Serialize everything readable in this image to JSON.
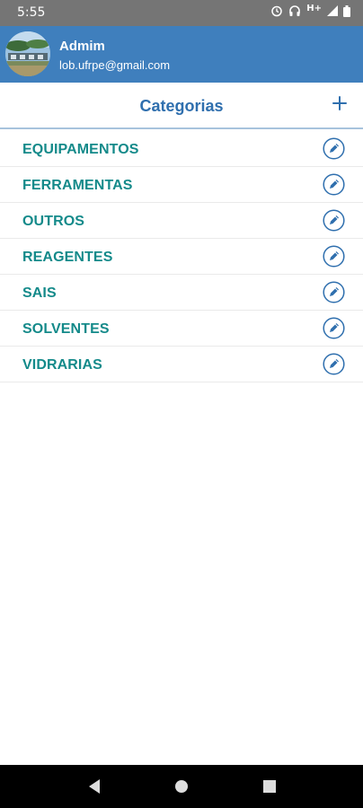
{
  "status_bar": {
    "time": "5:55",
    "network_label": "H+",
    "icons": [
      "alarm-icon",
      "headphones-icon",
      "signal-icon",
      "battery-icon"
    ]
  },
  "drawer_header": {
    "user_name": "Admim",
    "user_email": "lob.ufrpe@gmail.com",
    "background_color": "#3f7fbd"
  },
  "page": {
    "title": "Categorias",
    "add_icon": "plus-icon"
  },
  "categories": [
    {
      "label": "EQUIPAMENTOS"
    },
    {
      "label": "FERRAMENTAS"
    },
    {
      "label": "OUTROS"
    },
    {
      "label": "REAGENTES"
    },
    {
      "label": "SAIS"
    },
    {
      "label": "SOLVENTES"
    },
    {
      "label": "VIDRARIAS"
    }
  ],
  "nav_bar": {
    "buttons": [
      "back-icon",
      "home-icon",
      "recents-icon"
    ]
  },
  "colors": {
    "accent_blue": "#2f6fae",
    "category_text": "#148a8a"
  }
}
